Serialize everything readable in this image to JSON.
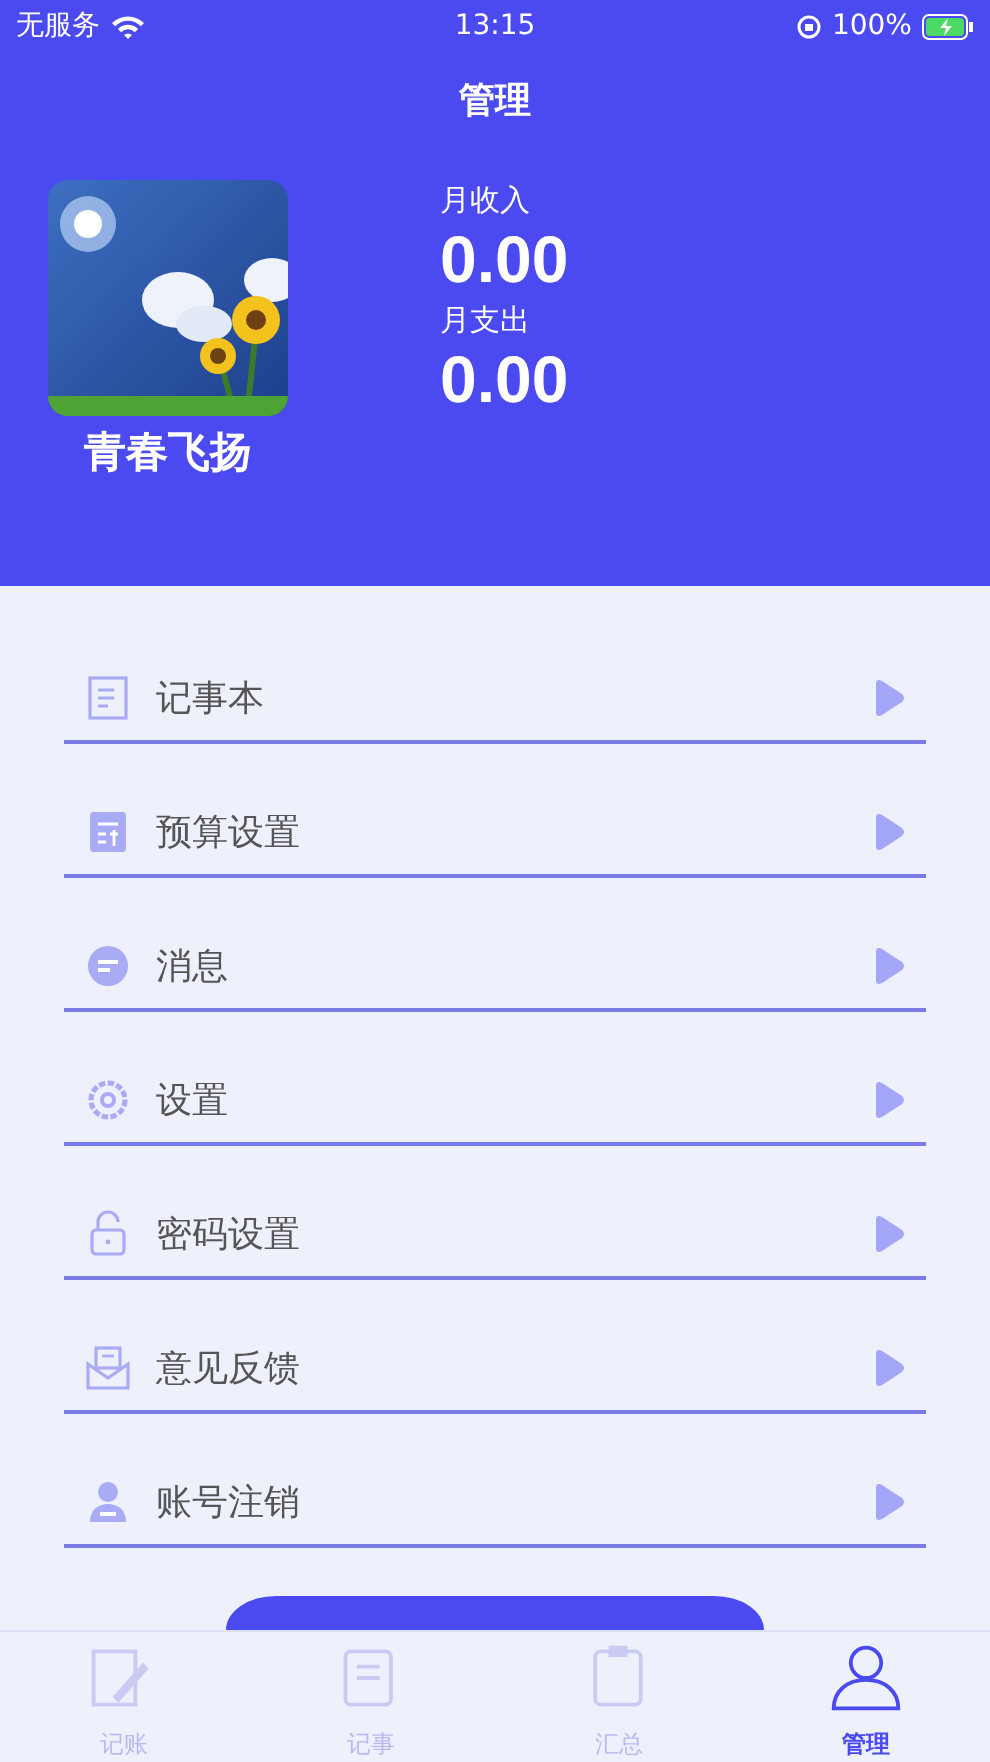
{
  "status_bar": {
    "carrier": "无服务",
    "time": "13:15",
    "battery": "100%"
  },
  "header": {
    "title": "管理",
    "user_name": "青春飞扬",
    "income_label": "月收入",
    "income": "0.00",
    "expense_label": "月支出",
    "expense": "0.00"
  },
  "menu": [
    {
      "label": "记事本"
    },
    {
      "label": "预算设置"
    },
    {
      "label": "消息"
    },
    {
      "label": "设置"
    },
    {
      "label": "密码设置"
    },
    {
      "label": "意见反馈"
    },
    {
      "label": "账号注销"
    }
  ],
  "tab_bar": [
    {
      "label": "记账",
      "selected": false
    },
    {
      "label": "记事",
      "selected": false
    },
    {
      "label": "汇总",
      "selected": false
    },
    {
      "label": "管理",
      "selected": true
    }
  ]
}
